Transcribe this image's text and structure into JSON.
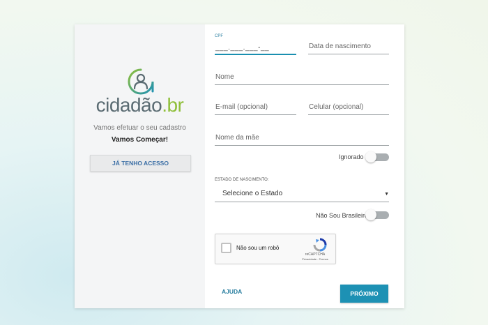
{
  "brand": {
    "name_main": "cidadão",
    "name_suffix": ".br",
    "accent_teal": "#1d91b4",
    "accent_green": "#8fbf3a"
  },
  "left_panel": {
    "subtitle": "Vamos efetuar o seu cadastro",
    "headline": "Vamos Começar!",
    "login_button": "JÁ TENHO ACESSO"
  },
  "form": {
    "cpf": {
      "label": "CPF",
      "value": "___.___.___-__"
    },
    "birth_date": {
      "placeholder": "Data de nascimento"
    },
    "name": {
      "placeholder": "Nome"
    },
    "email": {
      "placeholder": "E-mail (opcional)"
    },
    "phone": {
      "placeholder": "Celular (opcional)"
    },
    "mother_name": {
      "placeholder": "Nome da mãe"
    },
    "ignored_toggle": {
      "label": "Ignorado",
      "on": false
    },
    "birth_state": {
      "label": "ESTADO DE NASCIMENTO:",
      "selected": "Selecione o Estado"
    },
    "not_brazilian_toggle": {
      "label": "Não Sou Brasileiro",
      "on": false
    }
  },
  "captcha": {
    "label": "Não sou um robô",
    "brand": "reCAPTCHA",
    "links": "Privacidade - Termos"
  },
  "actions": {
    "help": "AJUDA",
    "next": "PRÓXIMO"
  }
}
